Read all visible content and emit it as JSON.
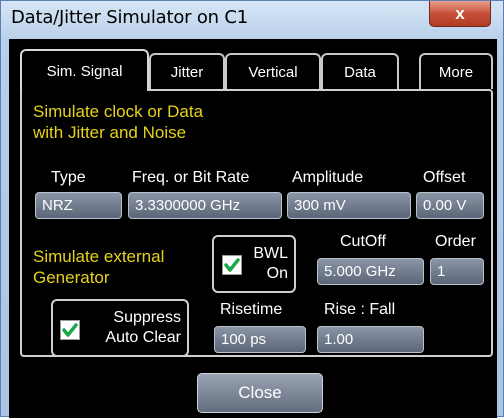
{
  "window": {
    "title": "Data/Jitter Simulator on C1",
    "close_glyph": "x"
  },
  "tabs": [
    {
      "label": "Sim. Signal"
    },
    {
      "label": "Jitter"
    },
    {
      "label": "Vertical"
    },
    {
      "label": "Data"
    },
    {
      "label": "More"
    }
  ],
  "active_tab": "Sim. Signal",
  "sim_signal": {
    "heading_line1": "Simulate clock or Data",
    "heading_line2": "with Jitter and Noise",
    "type": {
      "label": "Type",
      "value": "NRZ"
    },
    "freq": {
      "label": "Freq. or Bit Rate",
      "value": "3.3300000 GHz"
    },
    "amplitude": {
      "label": "Amplitude",
      "value": "300 mV"
    },
    "offset": {
      "label": "Offset",
      "value": "0.00 V"
    },
    "ext_gen_line1": "Simulate external",
    "ext_gen_line2": "Generator",
    "bwl": {
      "line1": "BWL",
      "line2": "On",
      "checked": true
    },
    "cutoff": {
      "label": "CutOff",
      "value": "5.000 GHz"
    },
    "order": {
      "label": "Order",
      "value": "1"
    },
    "suppress": {
      "line1": "Suppress",
      "line2": "Auto Clear",
      "checked": true
    },
    "risetime": {
      "label": "Risetime",
      "value": "100 ps"
    },
    "rise_fall": {
      "label": "Rise : Fall",
      "value": "1.00"
    }
  },
  "footer": {
    "close_label": "Close"
  },
  "colors": {
    "accent_text": "#e6d21a",
    "check_mark": "#1aa84a",
    "background": "#000000",
    "title_bar": "#b8cfe9"
  }
}
